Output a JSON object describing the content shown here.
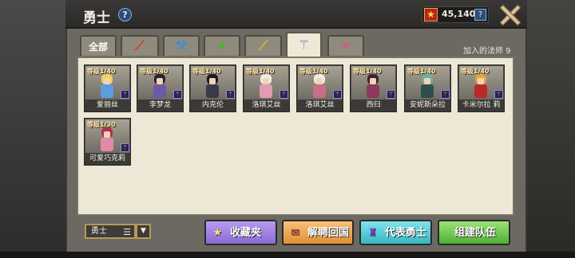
{
  "header": {
    "title": "勇士",
    "help": "?"
  },
  "currency": {
    "value": "45,140",
    "icon": "gem-icon",
    "help": "?"
  },
  "tabs": [
    {
      "label": "全部",
      "icon": "",
      "color": "#ffffff"
    },
    {
      "label": "",
      "icon": "sword-icon",
      "color": "#d83a2f",
      "glyph": "⟋"
    },
    {
      "label": "",
      "icon": "hammer-icon",
      "color": "#3a8de0",
      "glyph": "⚒"
    },
    {
      "label": "",
      "icon": "bow-icon",
      "color": "#4fae38",
      "glyph": "⌖"
    },
    {
      "label": "",
      "icon": "gun-icon",
      "color": "#d9b13a",
      "glyph": "⟋"
    },
    {
      "label": "",
      "icon": "staff-icon",
      "color": "#9a6ce0",
      "glyph": "⚚"
    },
    {
      "label": "",
      "icon": "pendant-icon",
      "color": "#e04f8f",
      "glyph": "⚭"
    }
  ],
  "mage_count": "加入的法师 9",
  "heroes": [
    {
      "level": "等级1/40",
      "name": "爱丽丝",
      "hair": "#f2d25a",
      "outfit": "#5f9be0"
    },
    {
      "level": "等级1/40",
      "name": "李梦龙",
      "hair": "#2b2230",
      "outfit": "#6c5aa8"
    },
    {
      "level": "等级1/40",
      "name": "内克伦",
      "hair": "#1e1c22",
      "outfit": "#3c3a48"
    },
    {
      "level": "等级1/40",
      "name": "洛琪艾丝",
      "hair": "#f1ece2",
      "outfit": "#e09cb0"
    },
    {
      "level": "等级1/40",
      "name": "洛琪艾丝",
      "hair": "#f1ece2",
      "outfit": "#c66f86"
    },
    {
      "level": "等级1/40",
      "name": "西归",
      "hair": "#3d2430",
      "outfit": "#8c3a5a"
    },
    {
      "level": "等级1/40",
      "name": "安妮斯朵拉",
      "hair": "#6cb39c",
      "outfit": "#2e4f4a"
    },
    {
      "level": "等级1/40",
      "name": "卡米尔拉 莉",
      "hair": "#e6a43a",
      "outfit": "#b82a2a"
    },
    {
      "level": "等级1/30",
      "name": "可爱巧克莉",
      "hair": "#b0324e",
      "outfit": "#e28aa8"
    }
  ],
  "footer": {
    "filter_label": "勇士",
    "filter_lines": "☰",
    "filter_arrow": "▼",
    "buttons": {
      "favorites": "收藏夹",
      "dismiss": "解聘回国",
      "representative": "代表勇士",
      "build_team": "组建队伍"
    },
    "icons": {
      "favorites": "★",
      "dismiss": "✉",
      "representative": "♜"
    }
  },
  "class_badge": "⚚"
}
